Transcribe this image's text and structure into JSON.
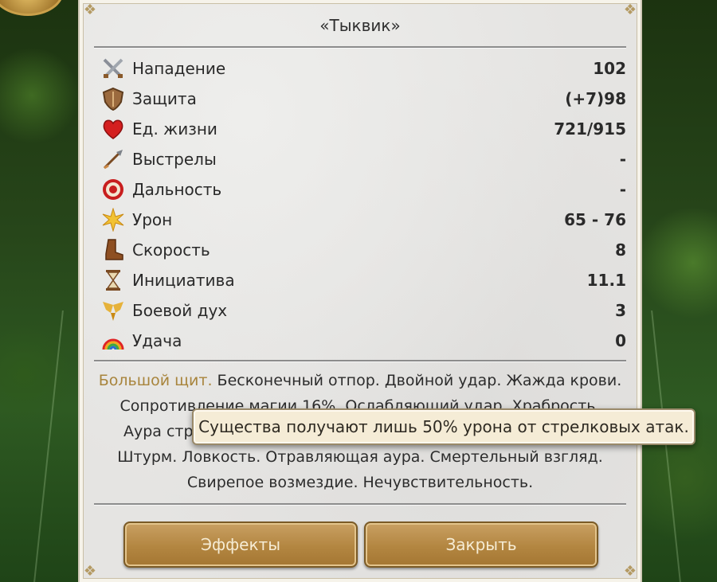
{
  "creature": {
    "title": "«Тыквик»"
  },
  "stats": [
    {
      "icon": "crossed-swords-icon",
      "label": "Нападение",
      "value": "102"
    },
    {
      "icon": "shield-icon",
      "label": "Защита",
      "value": "(+7)98"
    },
    {
      "icon": "heart-icon",
      "label": "Ед. жизни",
      "value": "721/915"
    },
    {
      "icon": "arrow-shots-icon",
      "label": "Выстрелы",
      "value": "-"
    },
    {
      "icon": "target-icon",
      "label": "Дальность",
      "value": "-"
    },
    {
      "icon": "burst-damage-icon",
      "label": "Урон",
      "value": "65 - 76"
    },
    {
      "icon": "boot-icon",
      "label": "Скорость",
      "value": "8"
    },
    {
      "icon": "hourglass-icon",
      "label": "Инициатива",
      "value": "11.1"
    },
    {
      "icon": "winged-morale-icon",
      "label": "Боевой дух",
      "value": "3"
    },
    {
      "icon": "rainbow-icon",
      "label": "Удача",
      "value": "0"
    }
  ],
  "abilities": {
    "highlighted": "Большой щит.",
    "line1_rest": " Бесконечный отпор. Двойной удар. Жажда крови.",
    "line2": "Сопротивление магии 16%. Ослабляющий удар. Храбрость.",
    "line3": "Аура стр",
    "line4": "Штурм. Ловкость. Отравляющая аура. Смертельный взгляд.",
    "line5": "Свирепое возмездие. Нечувствительность."
  },
  "tooltip": {
    "text": "Существа получают лишь 50% урона от стрелковых атак."
  },
  "buttons": {
    "effects": "Эффекты",
    "close": "Закрыть"
  },
  "colors": {
    "ability_highlight": "#a8843c",
    "button": "#b38641",
    "panel": "#e5e4e2"
  }
}
